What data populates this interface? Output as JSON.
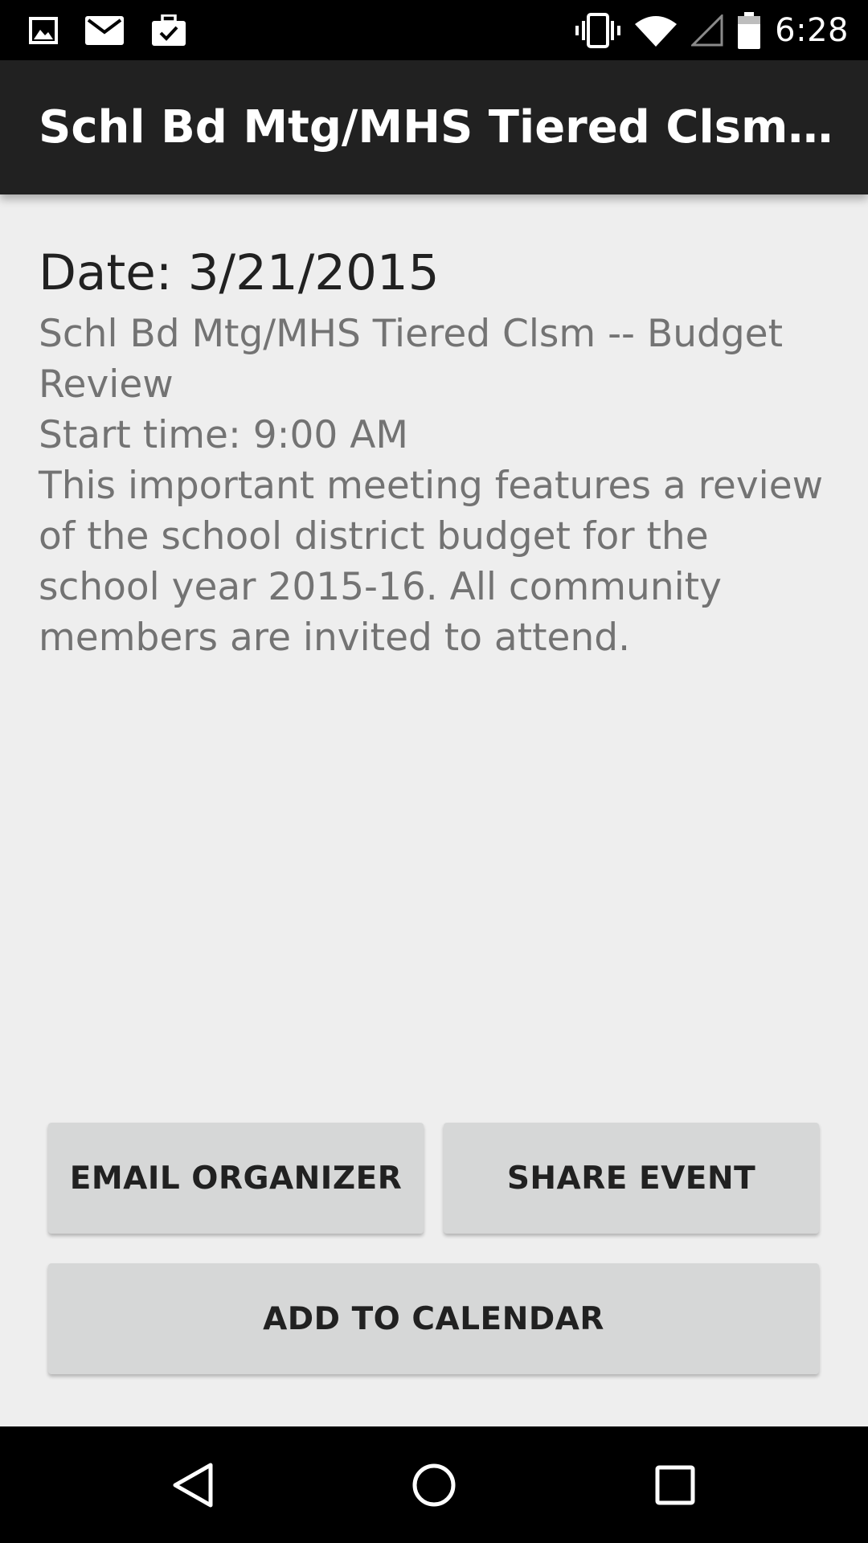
{
  "status_bar": {
    "time": "6:28",
    "icons": [
      "image-notification-icon",
      "mail-icon",
      "briefcase-check-icon",
      "vibrate-icon",
      "wifi-icon",
      "cell-signal-icon",
      "battery-icon"
    ]
  },
  "toolbar": {
    "title": "Schl Bd Mtg/MHS Tiered Clsm -- Budget Review"
  },
  "event": {
    "date_line": "Date: 3/21/2015",
    "name": "Schl Bd Mtg/MHS Tiered Clsm -- Budget Review",
    "start_line": "Start time: 9:00 AM",
    "description": "This important meeting features a review of the school district budget for the school year 2015-16. All community members are invited to attend."
  },
  "actions": {
    "email_label": "EMAIL ORGANIZER",
    "share_label": "SHARE EVENT",
    "calendar_label": "ADD TO CALENDAR"
  },
  "nav_bar": {
    "icons": [
      "back-icon",
      "home-icon",
      "recents-icon"
    ]
  },
  "colors": {
    "status_bar": "#000000",
    "toolbar": "#212121",
    "background": "#eeeeee",
    "button": "#d6d7d7",
    "secondary_text": "#737373"
  }
}
